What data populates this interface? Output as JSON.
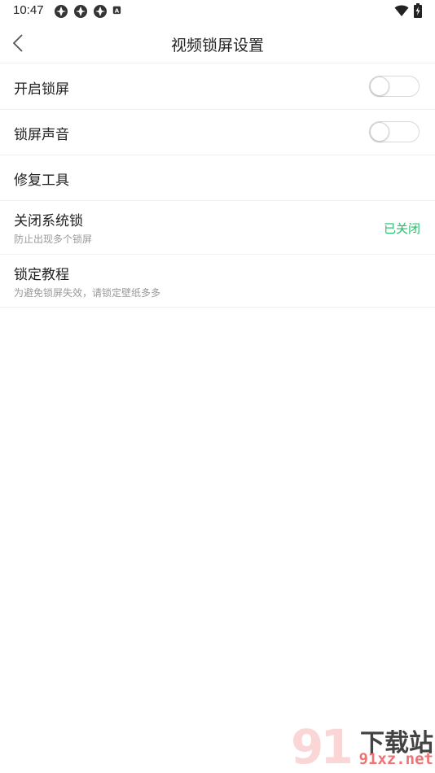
{
  "status_bar": {
    "time": "10:47",
    "left_icons": [
      "app-notification-icon",
      "app-notification-icon",
      "app-notification-icon",
      "keyboard-a-icon"
    ],
    "right_icons": [
      "wifi-icon",
      "battery-charging-icon"
    ]
  },
  "header": {
    "title": "视频锁屏设置",
    "back_icon": "chevron-left-icon"
  },
  "settings": [
    {
      "title": "开启锁屏",
      "control": "toggle",
      "on": false
    },
    {
      "title": "锁屏声音",
      "control": "toggle",
      "on": false
    },
    {
      "title": "修复工具"
    },
    {
      "title": "关闭系统锁",
      "subtitle": "防止出现多个锁屏",
      "status": "已关闭"
    },
    {
      "title": "锁定教程",
      "subtitle": "为避免锁屏失效，请锁定壁纸多多"
    }
  ],
  "colors": {
    "status_green": "#22c06b",
    "divider": "#f0f0f0",
    "subtitle_gray": "#999999"
  },
  "watermark": {
    "mark": "91",
    "top": "下载站",
    "bottom": "91xz.net"
  }
}
